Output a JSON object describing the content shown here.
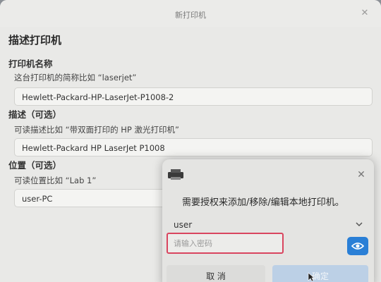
{
  "window": {
    "title": "新打印机"
  },
  "main": {
    "heading": "描述打印机",
    "name_label": "打印机名称",
    "name_hint": "这台打印机的简称比如 “laserjet”",
    "name_value": "Hewlett-Packard-HP-LaserJet-P1008-2",
    "desc_label": "描述（可选）",
    "desc_hint": "可读描述比如 “带双面打印的 HP 激光打印机”",
    "desc_value": "Hewlett-Packard HP LaserJet P1008",
    "loc_label": "位置（可选）",
    "loc_hint": "可读位置比如 “Lab 1”",
    "loc_value": "user-PC"
  },
  "dialog": {
    "message": "需要授权来添加/移除/编辑本地打印机。",
    "user": "user",
    "password_placeholder": "请输入密码",
    "cancel_label": "取 消",
    "confirm_label": "确定"
  },
  "colors": {
    "accent": "#2a7fd6",
    "highlight": "#d9455f"
  }
}
